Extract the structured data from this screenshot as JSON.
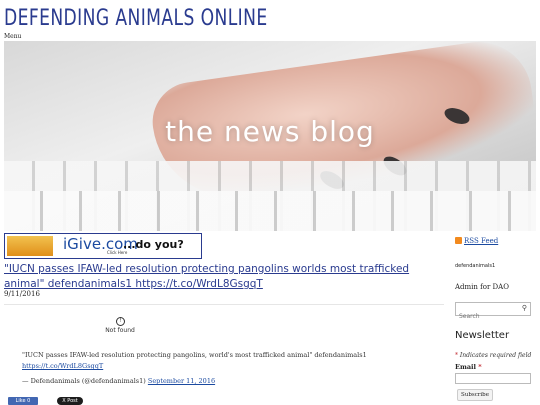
{
  "site": {
    "title": "DEFENDING ANIMALS ONLINE",
    "menu_label": "Menu"
  },
  "hero": {
    "text": "the news blog"
  },
  "banner": {
    "brand": "iGive.com",
    "tagline": "...do you?",
    "cta": "Click Here"
  },
  "post": {
    "title": "\"IUCN passes IFAW-led resolution protecting pangolins worlds most trafficked animal\" defendanimals1 https://t.co/WrdL8GsgqT",
    "date": "9/11/2016",
    "embed_status": "Not found",
    "tweet_text": "\"IUCN passes IFAW-led resolution protecting pangolins, world's most trafficked animal\" defendanimals1",
    "tweet_link": "https://t.co/WrdL8GsgqT",
    "tweet_attribution": "— Defendanimals (@defendanimals1)",
    "tweet_date": "September 11, 2016",
    "like_label": "Like 0",
    "xpost_label": "X Post"
  },
  "sidebar": {
    "rss_label": "RSS Feed",
    "username": "defendanimals1",
    "role": "Admin for DAO",
    "search_placeholder": "Search",
    "newsletter_title": "Newsletter",
    "required_note": "Indicates required field",
    "email_label": "Email",
    "subscribe_label": "Subscribe"
  },
  "colors": {
    "title": "#2a3b8f",
    "link": "#1b4aa0",
    "required": "#c0262d",
    "rss": "#f28a1e"
  }
}
